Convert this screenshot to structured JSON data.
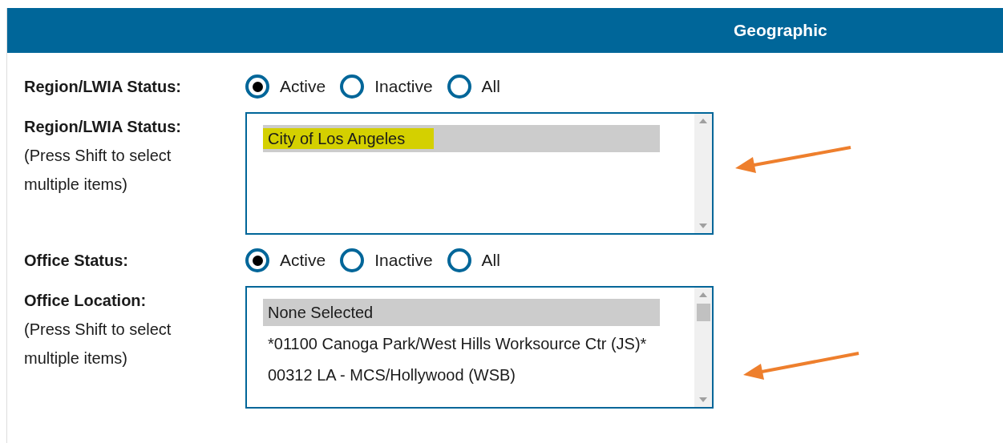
{
  "header": {
    "title": "Geographic"
  },
  "rows": [
    {
      "kind": "radio",
      "label": "Region/LWIA Status:",
      "options": [
        {
          "label": "Active",
          "selected": true
        },
        {
          "label": "Inactive",
          "selected": false
        },
        {
          "label": "All",
          "selected": false
        }
      ]
    },
    {
      "kind": "listbox",
      "label": "Region/LWIA Status:",
      "hint": "(Press Shift to select multiple items)",
      "scroll_thumb": false,
      "items": [
        {
          "label": "City of Los Angeles",
          "selected": true,
          "highlighted": true
        }
      ]
    },
    {
      "kind": "radio",
      "label": "Office Status:",
      "options": [
        {
          "label": "Active",
          "selected": true
        },
        {
          "label": "Inactive",
          "selected": false
        },
        {
          "label": "All",
          "selected": false
        }
      ]
    },
    {
      "kind": "listbox",
      "label": "Office Location:",
      "hint": "(Press Shift to select multiple items)",
      "scroll_thumb": true,
      "items": [
        {
          "label": "None Selected",
          "selected": true,
          "highlighted": false
        },
        {
          "label": "*01100 Canoga Park/West Hills Worksource Ctr (JS)*",
          "selected": false,
          "highlighted": false
        },
        {
          "label": "00312 LA - MCS/Hollywood (WSB)",
          "selected": false,
          "highlighted": false
        }
      ]
    }
  ]
}
